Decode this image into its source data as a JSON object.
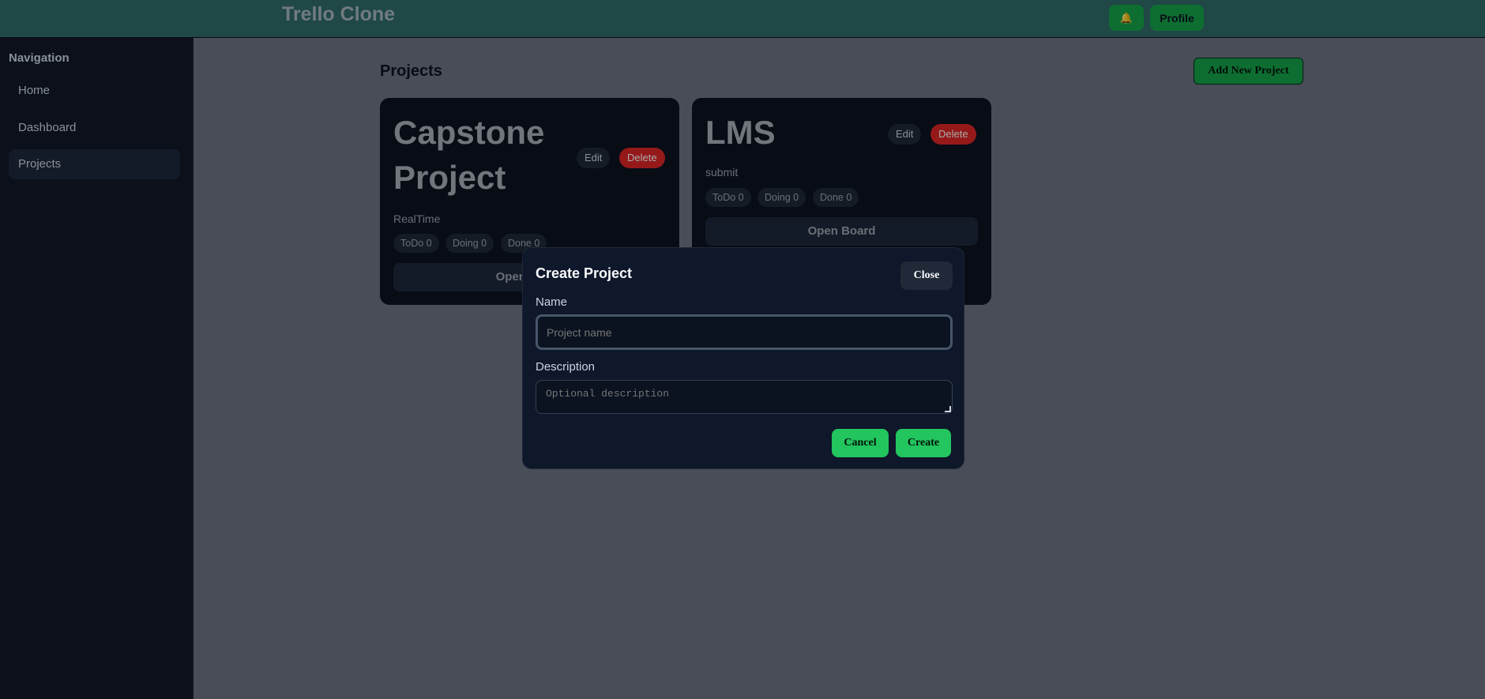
{
  "header": {
    "app_title": "Trello Clone",
    "bell_icon": "🔔",
    "profile_label": "Profile"
  },
  "sidebar": {
    "heading": "Navigation",
    "items": [
      {
        "label": "Home"
      },
      {
        "label": "Dashboard"
      },
      {
        "label": "Projects",
        "active": true
      }
    ]
  },
  "main": {
    "title": "Projects",
    "add_button_label": "Add New Project",
    "cards": [
      {
        "title_line1": "Capstone",
        "title_line2": "Project",
        "description": "RealTime",
        "edit_label": "Edit",
        "delete_label": "Delete",
        "chips": [
          "ToDo 0",
          "Doing 0",
          "Done 0"
        ],
        "open_label": "Open Board"
      },
      {
        "title_line1": "LMS",
        "description": "submit",
        "edit_label": "Edit",
        "delete_label": "Delete",
        "chips": [
          "ToDo 0",
          "Doing 0",
          "Done 0"
        ],
        "open_label": "Open Board"
      }
    ]
  },
  "modal": {
    "title": "Create Project",
    "close_label": "Close",
    "name_label": "Name",
    "name_placeholder": "Project name",
    "description_label": "Description",
    "description_placeholder": "Optional description",
    "cancel_label": "Cancel",
    "create_label": "Create"
  },
  "colors": {
    "header_bg": "#2f6b68",
    "accent_green": "#22c55e",
    "delete_red": "#dc2626",
    "sidebar_bg": "#111827",
    "card_bg": "#0b1220"
  }
}
